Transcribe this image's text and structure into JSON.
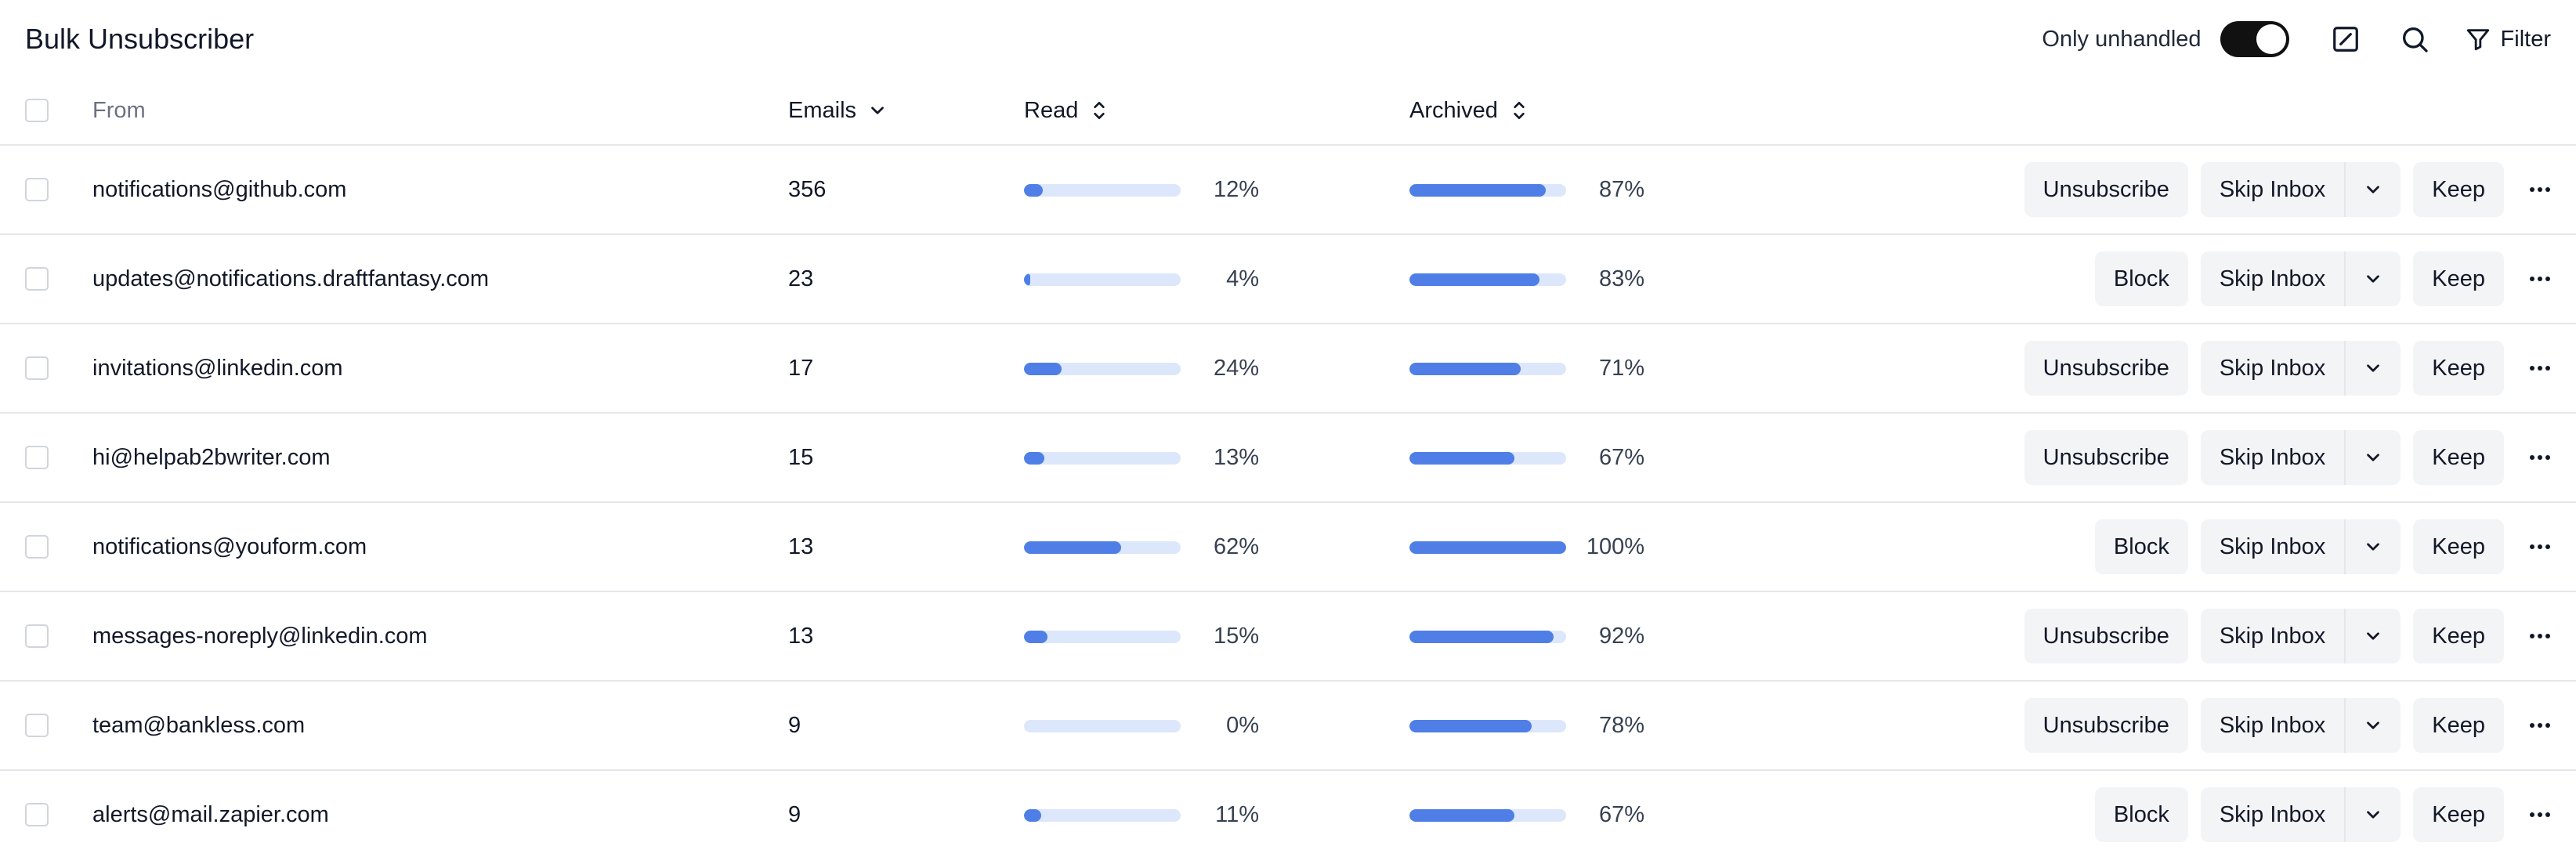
{
  "header": {
    "title": "Bulk Unsubscriber",
    "only_unhandled_label": "Only unhandled",
    "only_unhandled_on": true,
    "filter_label": "Filter"
  },
  "table": {
    "columns": {
      "from": "From",
      "emails": "Emails",
      "read": "Read",
      "archived": "Archived"
    },
    "rows": [
      {
        "from": "notifications@github.com",
        "emails": "356",
        "read_pct": 12,
        "read_label": "12%",
        "archived_pct": 87,
        "archived_label": "87%",
        "primary_action": "Unsubscribe"
      },
      {
        "from": "updates@notifications.draftfantasy.com",
        "emails": "23",
        "read_pct": 4,
        "read_label": "4%",
        "archived_pct": 83,
        "archived_label": "83%",
        "primary_action": "Block"
      },
      {
        "from": "invitations@linkedin.com",
        "emails": "17",
        "read_pct": 24,
        "read_label": "24%",
        "archived_pct": 71,
        "archived_label": "71%",
        "primary_action": "Unsubscribe"
      },
      {
        "from": "hi@helpab2bwriter.com",
        "emails": "15",
        "read_pct": 13,
        "read_label": "13%",
        "archived_pct": 67,
        "archived_label": "67%",
        "primary_action": "Unsubscribe"
      },
      {
        "from": "notifications@youform.com",
        "emails": "13",
        "read_pct": 62,
        "read_label": "62%",
        "archived_pct": 100,
        "archived_label": "100%",
        "primary_action": "Block"
      },
      {
        "from": "messages-noreply@linkedin.com",
        "emails": "13",
        "read_pct": 15,
        "read_label": "15%",
        "archived_pct": 92,
        "archived_label": "92%",
        "primary_action": "Unsubscribe"
      },
      {
        "from": "team@bankless.com",
        "emails": "9",
        "read_pct": 0,
        "read_label": "0%",
        "archived_pct": 78,
        "archived_label": "78%",
        "primary_action": "Unsubscribe"
      },
      {
        "from": "alerts@mail.zapier.com",
        "emails": "9",
        "read_pct": 11,
        "read_label": "11%",
        "archived_pct": 67,
        "archived_label": "67%",
        "primary_action": "Block"
      }
    ],
    "skip_inbox_label": "Skip Inbox",
    "keep_label": "Keep"
  },
  "colors": {
    "bar_fill": "#4f7fe6",
    "bar_track": "#dde7fb",
    "button_bg": "#f3f4f6",
    "toggle_on": "#111111"
  },
  "icons": {
    "edit": "square-pen-icon",
    "search": "search-icon",
    "filter": "filter-icon",
    "sort_desc": "chevron-down-icon",
    "sort_both": "chevrons-up-down-icon",
    "dropdown": "chevron-down-icon",
    "more": "more-horizontal-icon"
  }
}
